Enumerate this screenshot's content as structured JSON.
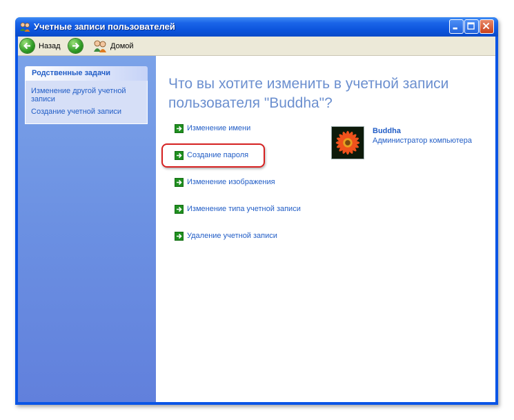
{
  "window": {
    "title": "Учетные записи пользователей"
  },
  "toolbar": {
    "back_label": "Назад",
    "home_label": "Домой"
  },
  "related_tasks": {
    "header": "Родственные задачи",
    "items": [
      {
        "label": "Изменение другой учетной записи"
      },
      {
        "label": "Создание учетной записи"
      }
    ]
  },
  "main": {
    "title_line1": "Что вы хотите изменить в учетной записи",
    "title_line2": "пользователя \"Buddha\"?",
    "actions": [
      {
        "label": "Изменение имени"
      },
      {
        "label": "Создание пароля"
      },
      {
        "label": "Изменение изображения"
      },
      {
        "label": "Изменение типа учетной записи"
      },
      {
        "label": "Удаление учетной записи"
      }
    ]
  },
  "user": {
    "name": "Buddha",
    "role": "Администратор компьютера",
    "picture_icon": "orange-flower-picture"
  },
  "colors": {
    "link": "#215dc6",
    "title": "#6b8fcf",
    "highlight": "#d62020",
    "side_pane": "#6b90e2"
  }
}
